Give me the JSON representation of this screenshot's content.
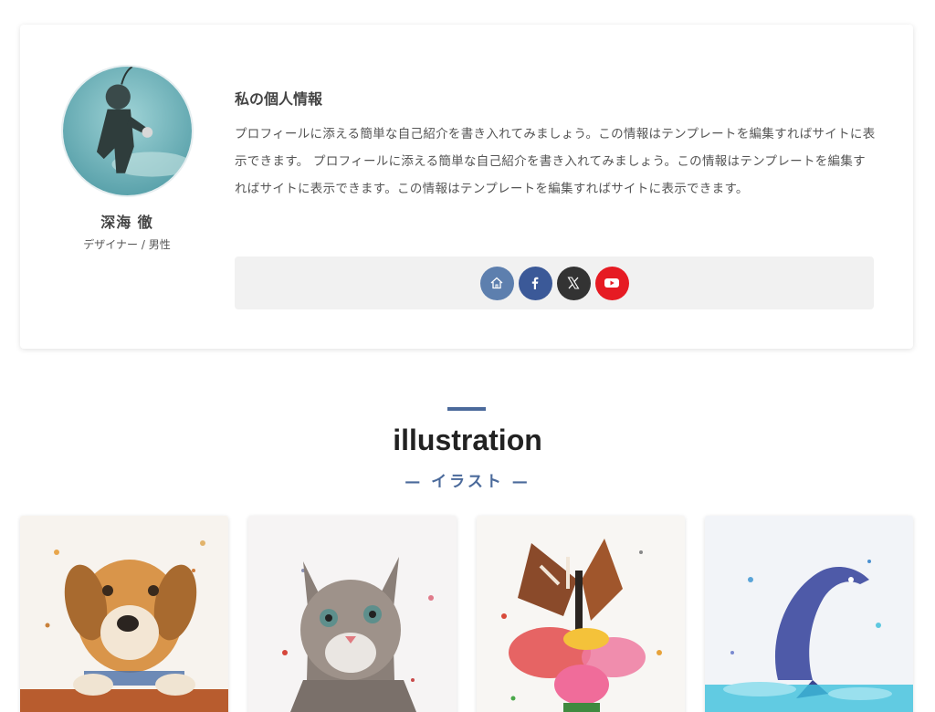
{
  "profile": {
    "heading": "私の個人情報",
    "text": "プロフィールに添える簡単な自己紹介を書き入れてみましょう。この情報はテンプレートを編集すればサイトに表示できます。 プロフィールに添える簡単な自己紹介を書き入れてみましょう。この情報はテンプレートを編集すればサイトに表示できます。この情報はテンプレートを編集すればサイトに表示できます。",
    "author_name": "深海 徹",
    "author_role": "デザイナー / 男性",
    "social": [
      {
        "icon": "home-icon",
        "color": "#5d7fae"
      },
      {
        "icon": "facebook-icon",
        "color": "#3b5998"
      },
      {
        "icon": "x-icon",
        "color": "#333333"
      },
      {
        "icon": "youtube-icon",
        "color": "#e61b23"
      }
    ]
  },
  "section": {
    "title": "illustration",
    "subtitle": "— イラスト —",
    "accent": "#4b6a9b"
  },
  "gallery": [
    {
      "icon": "dog-illustration"
    },
    {
      "icon": "cat-illustration"
    },
    {
      "icon": "butterfly-illustration"
    },
    {
      "icon": "dolphin-illustration"
    }
  ]
}
